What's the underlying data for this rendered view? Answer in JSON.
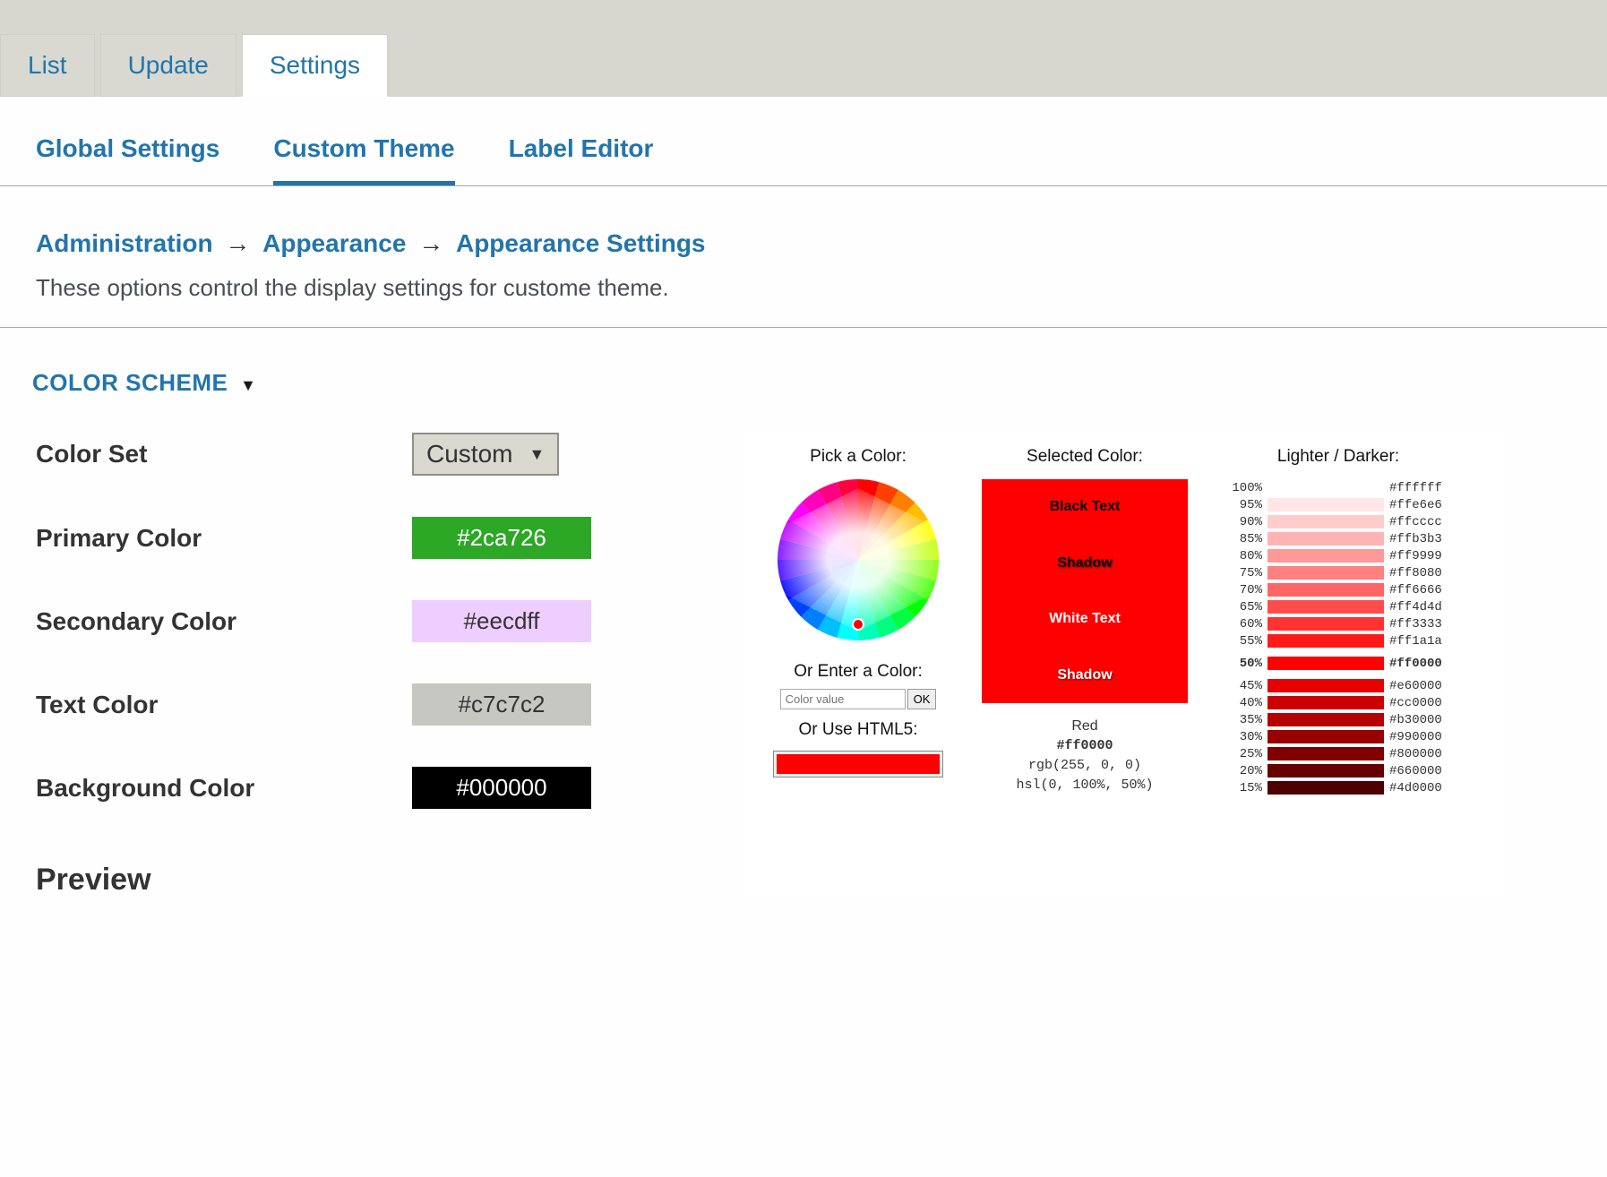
{
  "topTabs": {
    "list": "List",
    "update": "Update",
    "settings": "Settings"
  },
  "subnav": {
    "global": "Global Settings",
    "custom": "Custom Theme",
    "label": "Label Editor"
  },
  "breadcrumb": {
    "a": "Administration",
    "b": "Appearance",
    "c": "Appearance Settings"
  },
  "pageDesc": "These options control the display settings for custome theme.",
  "sectionTitle": "COLOR SCHEME",
  "form": {
    "colorSetLabel": "Color Set",
    "colorSetValue": "Custom",
    "primaryLabel": "Primary Color",
    "primaryValue": "#2ca726",
    "primaryBg": "#2ca726",
    "primaryFg": "#ffffff",
    "secondaryLabel": "Secondary Color",
    "secondaryValue": "#eecdff",
    "secondaryBg": "#eecdff",
    "secondaryFg": "#333333",
    "textLabel": "Text Color",
    "textValue": "#c7c7c2",
    "textBg": "#c7c7c2",
    "textFg": "#333333",
    "bgLabel": "Background Color",
    "bgValue": "#000000",
    "bgBg": "#000000",
    "bgFg": "#ffffff"
  },
  "previewTitle": "Preview",
  "picker": {
    "pickLabel": "Pick a Color:",
    "enterLabel": "Or Enter a Color:",
    "inputPlaceholder": "Color value",
    "okLabel": "OK",
    "html5Label": "Or Use HTML5:",
    "selectedLabel": "Selected Color:",
    "blackText": "Black Text",
    "shadow": "Shadow",
    "whiteText": "White Text",
    "colorName": "Red",
    "colorHex": "#ff0000",
    "colorRgb": "rgb(255, 0, 0)",
    "colorHsl": "hsl(0, 100%, 50%)",
    "ldLabel": "Lighter / Darker:",
    "shades": [
      {
        "pct": "100%",
        "c": "#ffffff",
        "h": "#ffffff"
      },
      {
        "pct": "95%",
        "c": "#ffe6e6",
        "h": "#ffe6e6"
      },
      {
        "pct": "90%",
        "c": "#ffcccc",
        "h": "#ffcccc"
      },
      {
        "pct": "85%",
        "c": "#ffb3b3",
        "h": "#ffb3b3"
      },
      {
        "pct": "80%",
        "c": "#ff9999",
        "h": "#ff9999"
      },
      {
        "pct": "75%",
        "c": "#ff8080",
        "h": "#ff8080"
      },
      {
        "pct": "70%",
        "c": "#ff6666",
        "h": "#ff6666"
      },
      {
        "pct": "65%",
        "c": "#ff4d4d",
        "h": "#ff4d4d"
      },
      {
        "pct": "60%",
        "c": "#ff3333",
        "h": "#ff3333"
      },
      {
        "pct": "55%",
        "c": "#ff1a1a",
        "h": "#ff1a1a"
      },
      {
        "pct": "50%",
        "c": "#ff0000",
        "h": "#ff0000",
        "curr": true
      },
      {
        "pct": "45%",
        "c": "#e60000",
        "h": "#e60000"
      },
      {
        "pct": "40%",
        "c": "#cc0000",
        "h": "#cc0000"
      },
      {
        "pct": "35%",
        "c": "#b30000",
        "h": "#b30000"
      },
      {
        "pct": "30%",
        "c": "#990000",
        "h": "#990000"
      },
      {
        "pct": "25%",
        "c": "#800000",
        "h": "#800000"
      },
      {
        "pct": "20%",
        "c": "#660000",
        "h": "#660000"
      },
      {
        "pct": "15%",
        "c": "#4d0000",
        "h": "#4d0000"
      }
    ]
  }
}
